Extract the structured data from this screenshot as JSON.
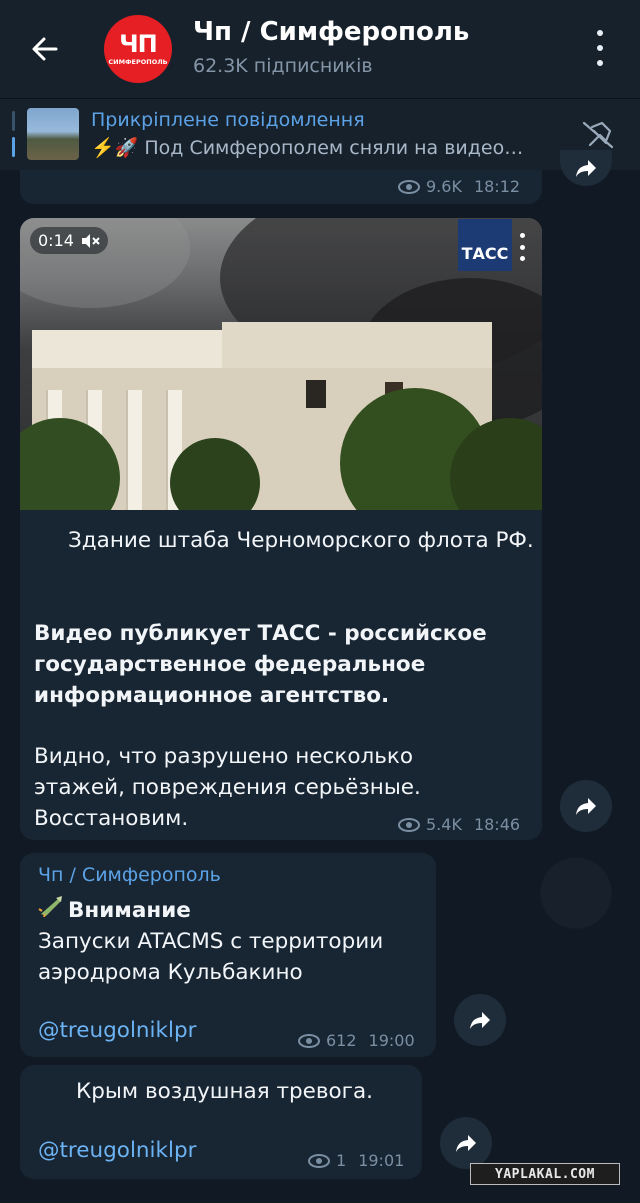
{
  "header": {
    "back_icon": "arrow-left-icon",
    "avatar_text_big": "ЧП",
    "avatar_text_small": "СИМФЕРОПОЛЬ",
    "title": "Чп / Симферополь",
    "subtitle": "62.3K підписників",
    "menu_icon": "more-vertical-icon"
  },
  "pinned": {
    "title": "Прикріплене повідомлення",
    "text": "⚡️🚀 Под Симферополем сняли на видео…",
    "unpin_icon": "unpin-icon"
  },
  "messages": [
    {
      "views": "9.6K",
      "time": "18:12"
    },
    {
      "video_duration": "0:14",
      "video_logo": "ТАСС",
      "text_1": "Здание штаба Черноморского флота РФ.",
      "text_2": "Видео публикует ТАСС - российское государственное федеральное информационное агентство.",
      "text_3": "Видно, что разрушено несколько этажей, повреждения серьёзные. Восстановим.",
      "views": "5.4K",
      "time": "18:46"
    },
    {
      "forwarded_from": "Чп / Симферополь",
      "heading": "Внимание",
      "text": "Запуски ATACMS с территории аэродрома Кульбакино",
      "link": "@treugolniklpr",
      "views": "612",
      "time": "19:00"
    },
    {
      "text": "Крым воздушная тревога.",
      "link": "@treugolniklpr",
      "views": "1",
      "time": "19:01"
    }
  ],
  "watermark": "YAPLAKAL.COM",
  "colors": {
    "accent": "#5ca2e6",
    "bubble": "#182533",
    "background": "#0e1621",
    "avatar": "#e61f24"
  }
}
